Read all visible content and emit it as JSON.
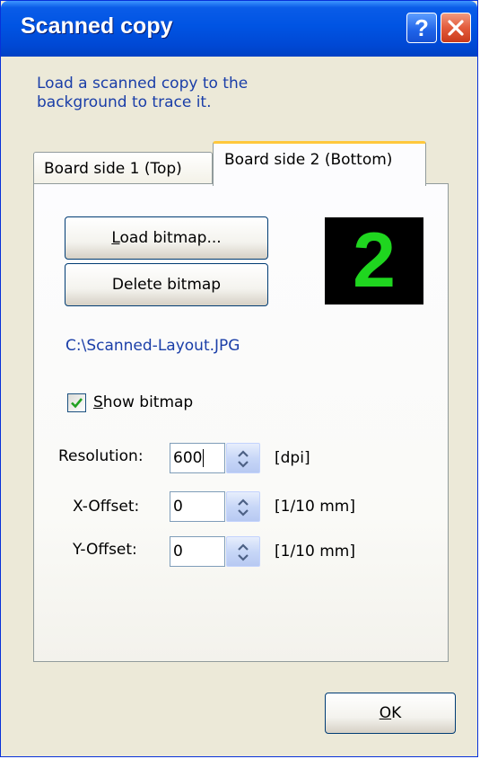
{
  "window": {
    "title": "Scanned copy",
    "help_label": "?"
  },
  "description": "Load a scanned copy to the background to trace it.",
  "tabs": [
    {
      "label": "Board side 1 (Top)",
      "selected": false
    },
    {
      "label": "Board side 2 (Bottom)",
      "selected": true
    }
  ],
  "buttons": {
    "load_bitmap": {
      "accel": "L",
      "rest": "oad bitmap..."
    },
    "delete_bitmap": "Delete bitmap",
    "ok": {
      "accel": "O",
      "rest": "K"
    }
  },
  "side_badge": "2",
  "file_path": "C:\\Scanned-Layout.JPG",
  "show_bitmap": {
    "accel": "S",
    "rest": "how bitmap",
    "checked": true
  },
  "fields": {
    "resolution": {
      "label": "Resolution:",
      "value": "600",
      "unit": "[dpi]"
    },
    "x_offset": {
      "label": "X-Offset:",
      "value": "0",
      "unit": "[1/10 mm]"
    },
    "y_offset": {
      "label": "Y-Offset:",
      "value": "0",
      "unit": "[1/10 mm]"
    }
  },
  "colors": {
    "titlebar": "#0054e3",
    "info_text": "#1a3ea8",
    "badge_bg": "#000000",
    "badge_fg": "#1fd61f",
    "active_tab_accent": "#ffc83c"
  }
}
